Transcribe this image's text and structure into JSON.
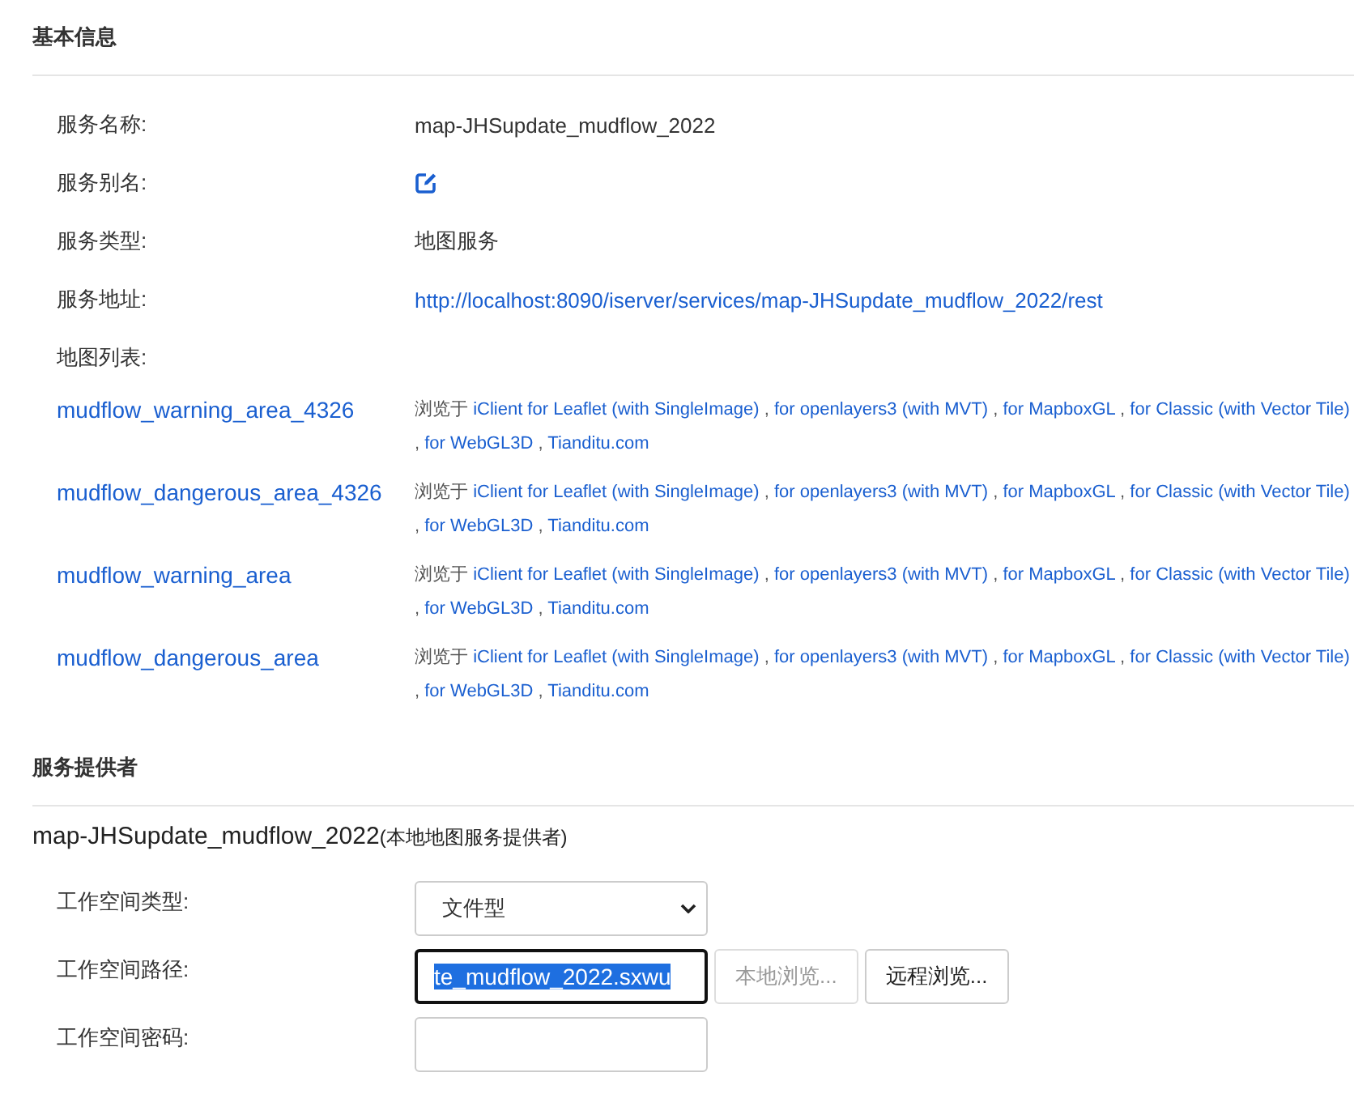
{
  "basic_info": {
    "title": "基本信息",
    "fields": [
      {
        "kind": "text",
        "label": "服务名称:",
        "value": "map-JHSupdate_mudflow_2022"
      },
      {
        "kind": "edit",
        "label": "服务别名:"
      },
      {
        "kind": "text",
        "label": "服务类型:",
        "value": "地图服务"
      },
      {
        "kind": "link",
        "label": "服务地址:",
        "value": "http://localhost:8090/iserver/services/map-JHSupdate_mudflow_2022/rest"
      },
      {
        "kind": "empty",
        "label": "地图列表:"
      }
    ],
    "maps": [
      {
        "name": "mudflow_warning_area_4326",
        "browse_label": "浏览于",
        "separator": ",",
        "links": [
          "iClient for Leaflet (with SingleImage)",
          "for openlayers3 (with MVT)",
          "for MapboxGL",
          "for Classic (with Vector Tile)",
          "for WebGL3D",
          "Tianditu.com"
        ]
      },
      {
        "name": "mudflow_dangerous_area_4326",
        "browse_label": "浏览于",
        "separator": ",",
        "links": [
          "iClient for Leaflet (with SingleImage)",
          "for openlayers3 (with MVT)",
          "for MapboxGL",
          "for Classic (with Vector Tile)",
          "for WebGL3D",
          "Tianditu.com"
        ]
      },
      {
        "name": "mudflow_warning_area",
        "browse_label": "浏览于",
        "separator": ",",
        "links": [
          "iClient for Leaflet (with SingleImage)",
          "for openlayers3 (with MVT)",
          "for MapboxGL",
          "for Classic (with Vector Tile)",
          "for WebGL3D",
          "Tianditu.com"
        ]
      },
      {
        "name": "mudflow_dangerous_area",
        "browse_label": "浏览于",
        "separator": ",",
        "links": [
          "iClient for Leaflet (with SingleImage)",
          "for openlayers3 (with MVT)",
          "for MapboxGL",
          "for Classic (with Vector Tile)",
          "for WebGL3D",
          "Tianditu.com"
        ]
      }
    ]
  },
  "provider": {
    "title": "服务提供者",
    "name": "map-JHSupdate_mudflow_2022",
    "type_note": "(本地地图服务提供者)",
    "fields": [
      {
        "kind": "select",
        "label": "工作空间类型:",
        "value": "文件型"
      },
      {
        "kind": "path",
        "label": "工作空间路径:",
        "value": "te_mudflow_2022.sxwu",
        "focused": true,
        "text_selected": true,
        "buttons": [
          {
            "label": "本地浏览...",
            "disabled": true
          },
          {
            "label": "远程浏览...",
            "disabled": false
          }
        ]
      },
      {
        "kind": "password",
        "label": "工作空间密码:"
      }
    ]
  }
}
